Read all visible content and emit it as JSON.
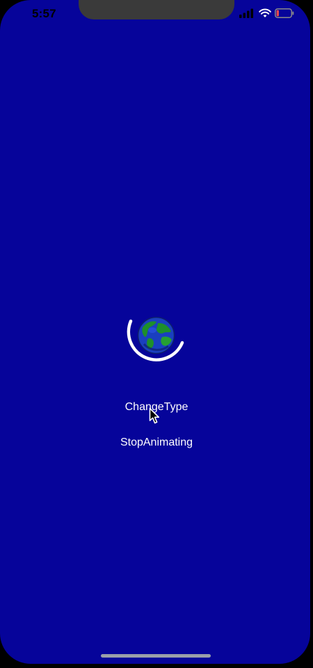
{
  "status_bar": {
    "time": "5:57",
    "icons": [
      "signal-icon",
      "wifi-icon",
      "battery-icon"
    ]
  },
  "colors": {
    "background": "#06049A",
    "text": "#FFFFFF",
    "battery_low": "#E5484D"
  },
  "loader": {
    "icons": [
      "spinner-arc-icon",
      "globe-icon"
    ]
  },
  "buttons": {
    "change_type": "ChangeType",
    "stop_animating": "StopAnimating"
  }
}
